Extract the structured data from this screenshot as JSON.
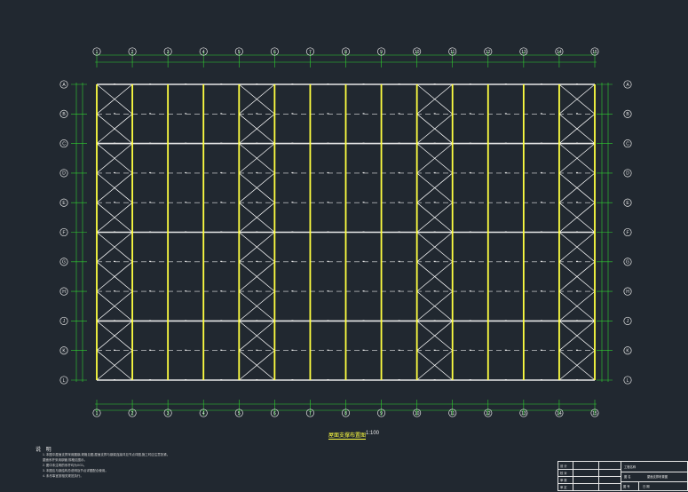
{
  "drawing": {
    "plan_title": "屋面支撑布置图",
    "plan_scale": "1:100",
    "grid_labels_x": [
      "1",
      "2",
      "3",
      "4",
      "5",
      "6",
      "7",
      "8",
      "9",
      "10",
      "11",
      "12",
      "13",
      "14",
      "15"
    ],
    "grid_labels_y": [
      "A",
      "B",
      "C",
      "D",
      "E",
      "F",
      "G",
      "H",
      "J",
      "K",
      "L"
    ],
    "braced_bays": [
      1,
      5,
      10,
      14
    ],
    "colors": {
      "background": "#212830",
      "beam": "#ffff40",
      "grid": "#e8e8e8",
      "bracing": "#ffffff",
      "dimension": "#30d030"
    }
  },
  "notes": {
    "title": "说 明",
    "items": [
      "1. 本图中屋面支撑采用圆钢,规格见图,屋面支撑与钢梁连接详见节点详图,施工时应注意张紧。",
      "   屋面系杆采用钢管,规格见图示。",
      "2. 图中未注明的系杆均为XG1。",
      "3. 本图应与钢结构总说明及节点详图配合使用。",
      "4. 未尽事宜按相关规范执行。"
    ]
  },
  "title_block": {
    "cells": [
      "设 计",
      "校 对",
      "审 核",
      "审 定",
      "工程名称",
      "图 名",
      "屋面支撑布置图",
      "图 号",
      "日 期"
    ]
  }
}
